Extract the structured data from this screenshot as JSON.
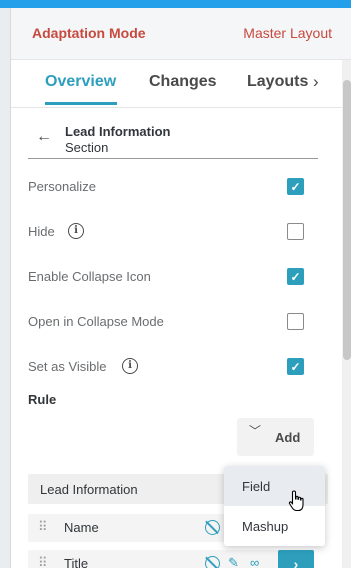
{
  "header": {
    "title": "Adaptation Mode",
    "layout_link": "Master Layout"
  },
  "tabs": [
    {
      "label": "Overview",
      "active": true
    },
    {
      "label": "Changes",
      "active": false
    },
    {
      "label": "Layouts",
      "active": false
    }
  ],
  "section": {
    "title": "Lead Information",
    "subtitle": "Section"
  },
  "options": [
    {
      "label": "Personalize",
      "checked": true,
      "info": false
    },
    {
      "label": "Hide",
      "checked": false,
      "info": true
    },
    {
      "label": "Enable Collapse Icon",
      "checked": true,
      "info": false
    },
    {
      "label": "Open in Collapse Mode",
      "checked": false,
      "info": false
    },
    {
      "label": "Set as Visible",
      "checked": true,
      "info": true
    }
  ],
  "rule": {
    "label": "Rule",
    "add_label": "Add"
  },
  "group": {
    "label": "Lead Information"
  },
  "fields": [
    {
      "label": "Name"
    },
    {
      "label": "Title"
    }
  ],
  "dropdown": {
    "items": [
      "Field",
      "Mashup"
    ]
  },
  "colors": {
    "accent": "#2d9fbd",
    "brand_red": "#c64a3f",
    "top_stripe": "#24a0ea"
  }
}
